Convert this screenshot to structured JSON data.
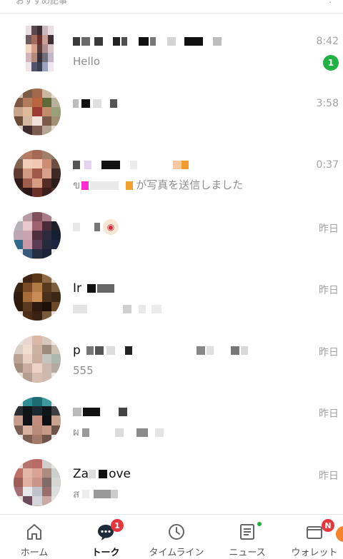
{
  "header": {
    "label": "おすすめ記事"
  },
  "chats": [
    {
      "name": "",
      "preview": "Hello",
      "time": "8:42",
      "unread": "1"
    },
    {
      "name": "",
      "preview": "",
      "time": "3:58"
    },
    {
      "name": "",
      "preview_prefix": "ข",
      "preview": "が写真を送信しました",
      "time": "0:37"
    },
    {
      "name": "",
      "preview": "",
      "time": "昨日"
    },
    {
      "name": "Ir",
      "preview": "",
      "time": "昨日"
    },
    {
      "name": "p",
      "preview": "555",
      "time": "昨日"
    },
    {
      "name": "",
      "preview": "ผ",
      "time": "昨日"
    },
    {
      "name": "Za",
      "name_suffix": "ove",
      "preview": "ส",
      "time": "昨日"
    }
  ],
  "nav": {
    "home": "ホーム",
    "talk": "トーク",
    "talk_badge": "1",
    "timeline": "タイムライン",
    "news": "ニュース",
    "wallet": "ウォレット",
    "wallet_badge": "N"
  },
  "colors": {
    "accent_green": "#1fb143",
    "badge_red": "#e6363d",
    "text_gray": "#8e8e8e",
    "orange": "#f2852b"
  }
}
